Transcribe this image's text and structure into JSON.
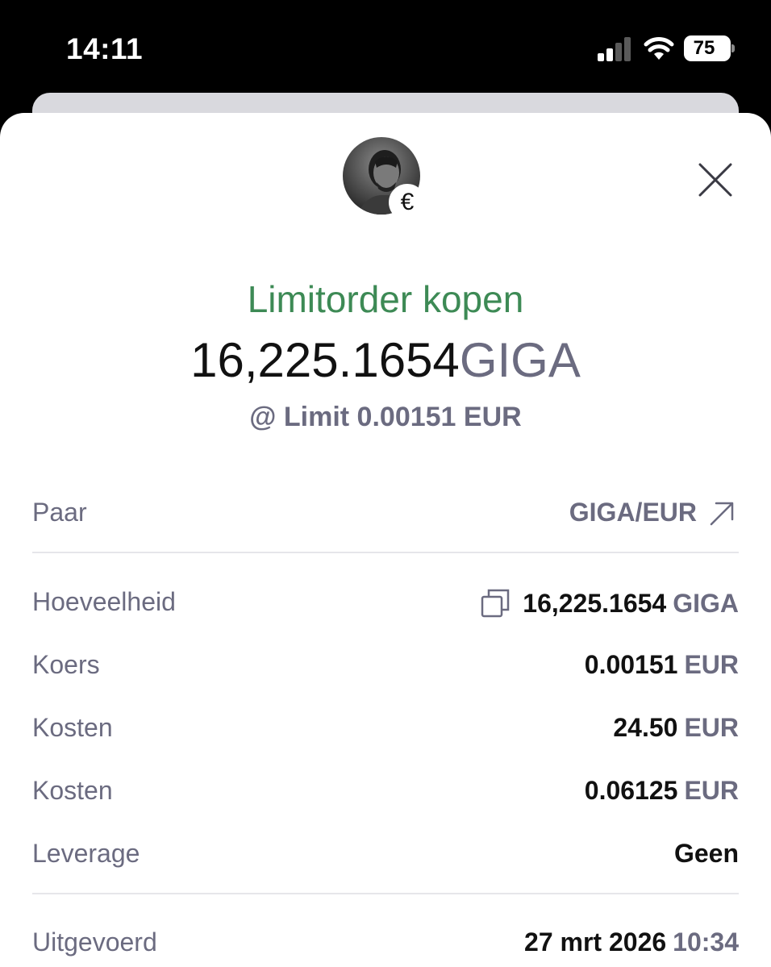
{
  "status_bar": {
    "time": "14:11",
    "battery": "75",
    "icons": [
      "signal-icon",
      "wifi-icon",
      "battery-icon"
    ]
  },
  "header": {
    "avatar_icon": "avatar-image",
    "badge": "€",
    "close_icon": "close-icon"
  },
  "order": {
    "title": "Limitorder kopen",
    "amount": "16,225.1654",
    "amount_unit": "GIGA",
    "limit": "@ Limit 0.00151 EUR"
  },
  "details": {
    "pair": {
      "label": "Paar",
      "value": "GIGA/EUR",
      "icon": "external-link-arrow-icon"
    },
    "quantity": {
      "label": "Hoeveelheid",
      "value": "16,225.1654",
      "unit": "GIGA",
      "icon": "copy-icon"
    },
    "rate": {
      "label": "Koers",
      "value": "0.00151",
      "unit": "EUR"
    },
    "cost1": {
      "label": "Kosten",
      "value": "24.50",
      "unit": "EUR"
    },
    "cost2": {
      "label": "Kosten",
      "value": "0.06125",
      "unit": "EUR"
    },
    "leverage": {
      "label": "Leverage",
      "value": "Geen"
    },
    "executed": {
      "label": "Uitgevoerd",
      "date": "27 mrt 2026",
      "time": "10:34"
    }
  },
  "colors": {
    "accent_green": "#3d8a55",
    "muted_text": "#6b6b80",
    "divider": "#e6e6ea"
  }
}
